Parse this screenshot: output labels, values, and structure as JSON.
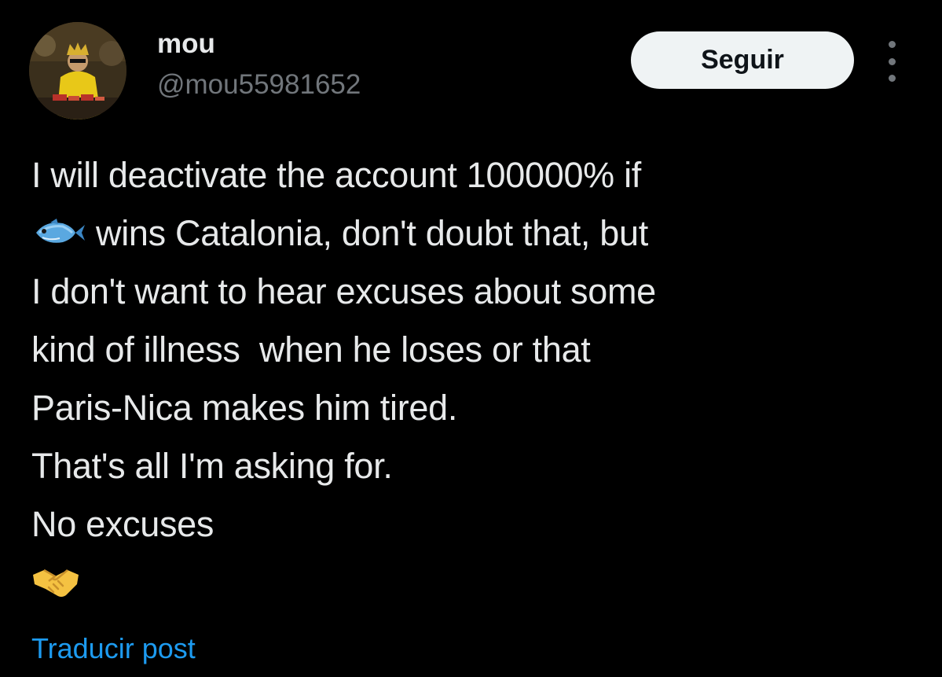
{
  "user": {
    "display_name": "mou",
    "handle": "@mou55981652",
    "avatar_icon": "avatar"
  },
  "actions": {
    "follow_label": "Seguir",
    "more_icon": "more-dots-icon"
  },
  "tweet": {
    "line1": "I will deactivate the account 100000% if",
    "line2_emoji": "fish-emoji",
    "line2": "wins Catalonia, don't doubt that, but",
    "line3": "I don't want to hear excuses about some",
    "line4": "kind of illness  when he loses or that",
    "line5": "Paris-Nica makes him tired.",
    "line6": "That's all I'm asking for.",
    "line7": "No excuses",
    "line8_emoji": "handshake-emoji"
  },
  "footer": {
    "translate_label": "Traducir post"
  },
  "colors": {
    "background": "#000000",
    "primary_text": "#e7e9ea",
    "secondary_text": "#71767b",
    "link": "#1d9bf0",
    "button_bg": "#eff3f4"
  }
}
